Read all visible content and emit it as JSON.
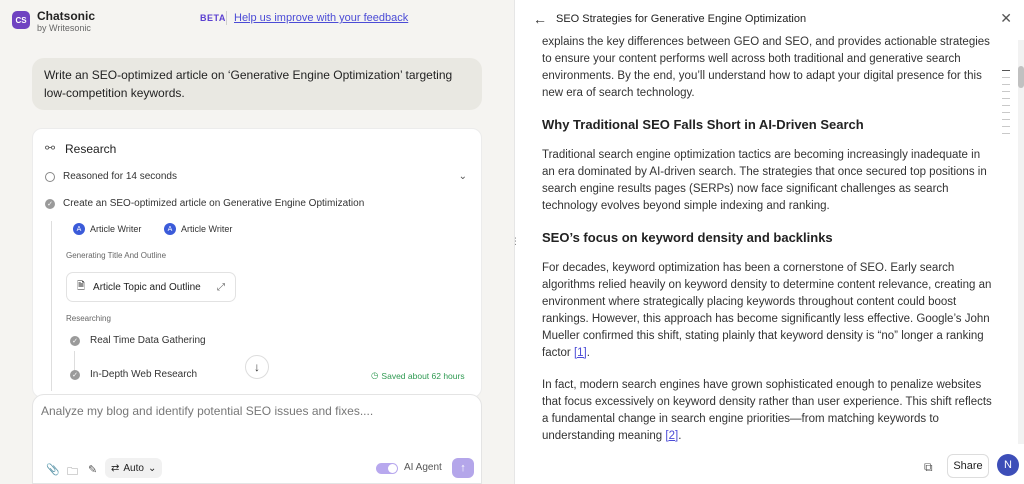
{
  "header": {
    "logo_text": "CS",
    "brand": "Chatsonic",
    "brand_sub": "by Writesonic",
    "beta": "BETA",
    "feedback_link": "Help us improve with your feedback"
  },
  "chat": {
    "user_message": "Write an SEO-optimized article on ‘Generative Engine Optimization’ targeting low-competition keywords.",
    "research": {
      "title": "Research",
      "reasoned": "Reasoned for 14 seconds",
      "task": "Create an SEO-optimized article on Generative Engine Optimization",
      "agents": [
        "Article Writer",
        "Article Writer"
      ],
      "generating_label": "Generating Title And Outline",
      "topic_box": "Article Topic and Outline",
      "researching_label": "Researching",
      "steps": [
        "Real Time Data Gathering",
        "In-Depth Web Research"
      ],
      "saved": "Saved about 62 hours"
    }
  },
  "composer": {
    "placeholder": "Analyze my blog and identify potential SEO issues and fixes....",
    "auto_label": "Auto",
    "ai_agent_label": "AI Agent"
  },
  "article_panel": {
    "title": "SEO Strategies for Generative Engine Optimization",
    "intro": "explains the key differences between GEO and SEO, and provides actionable strategies to ensure your content performs well across both traditional and generative search environments. By the end, you’ll understand how to adapt your digital presence for this new era of search technology.",
    "h1": "Why Traditional SEO Falls Short in AI-Driven Search",
    "p1": "Traditional search engine optimization tactics are becoming increasingly inadequate in an era dominated by AI-driven search. The strategies that once secured top positions in search engine results pages (SERPs) now face significant challenges as search technology evolves beyond simple indexing and ranking.",
    "h2": "SEO’s focus on keyword density and backlinks",
    "p2": "For decades, keyword optimization has been a cornerstone of SEO. Early search algorithms relied heavily on keyword density to determine content relevance, creating an environment where strategically placing keywords throughout content could boost rankings. However, this approach has become significantly less effective. Google’s John Mueller confirmed this shift, stating plainly that keyword density is “no” longer a ranking factor",
    "cite1": "[1]",
    "p3": "In fact, modern search engines have grown sophisticated enough to penalize websites that focus excessively on keyword density rather than user experience. This shift reflects a fundamental change in search engine priorities—from matching keywords to understanding meaning",
    "cite2": "[2]",
    "share": "Share",
    "avatar": "N"
  }
}
